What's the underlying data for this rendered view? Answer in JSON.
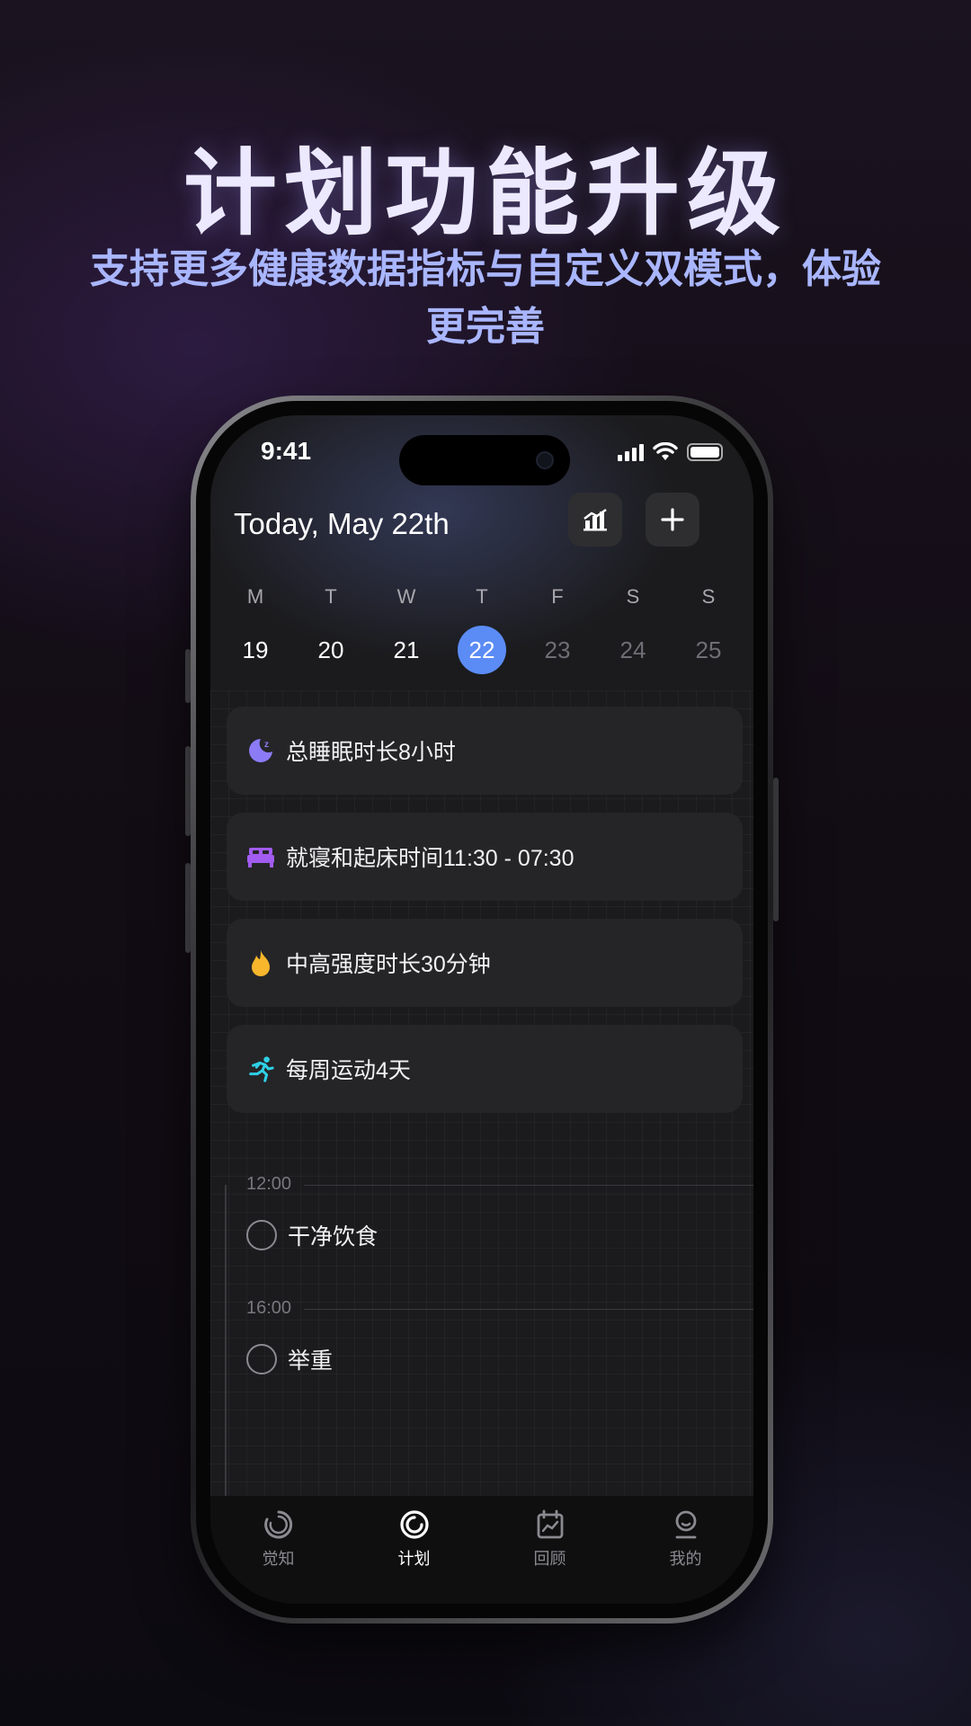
{
  "promo": {
    "headline": "计划功能升级",
    "subtitle": "支持更多健康数据指标与自定义双模式，体验更完善"
  },
  "status_bar": {
    "time": "9:41"
  },
  "header": {
    "title": "Today, May 22th",
    "buttons": [
      {
        "icon": "bar-chart-icon"
      },
      {
        "icon": "plus-icon"
      }
    ]
  },
  "week": {
    "days": [
      {
        "dow": "M",
        "num": "19",
        "state": "past"
      },
      {
        "dow": "T",
        "num": "20",
        "state": "past"
      },
      {
        "dow": "W",
        "num": "21",
        "state": "past"
      },
      {
        "dow": "T",
        "num": "22",
        "state": "selected"
      },
      {
        "dow": "F",
        "num": "23",
        "state": "future"
      },
      {
        "dow": "S",
        "num": "24",
        "state": "future"
      },
      {
        "dow": "S",
        "num": "25",
        "state": "future"
      }
    ]
  },
  "goals": [
    {
      "icon": "moon-sleep-icon",
      "color": "#8b7cf6",
      "label": "总睡眠时长8小时"
    },
    {
      "icon": "bed-icon",
      "color": "#a25cf0",
      "label": "就寝和起床时间11:30 - 07:30"
    },
    {
      "icon": "flame-icon",
      "color": "#f7b62b",
      "label": "中高强度时长30分钟"
    },
    {
      "icon": "running-person-icon",
      "color": "#2fd0e6",
      "label": "每周运动4天"
    }
  ],
  "timeline": [
    {
      "time": "12:00",
      "task": "干净饮食"
    },
    {
      "time": "16:00",
      "task": "举重"
    }
  ],
  "tabbar": {
    "tabs": [
      {
        "label": "觉知",
        "icon": "awareness-ring-icon",
        "active": false
      },
      {
        "label": "计划",
        "icon": "plan-target-icon",
        "active": true
      },
      {
        "label": "回顾",
        "icon": "review-calendar-icon",
        "active": false
      },
      {
        "label": "我的",
        "icon": "profile-icon",
        "active": false
      }
    ]
  },
  "colors": {
    "accent": "#5b8cf5",
    "headline": "#ece9ff",
    "subtitle": "#a9b6ff"
  }
}
